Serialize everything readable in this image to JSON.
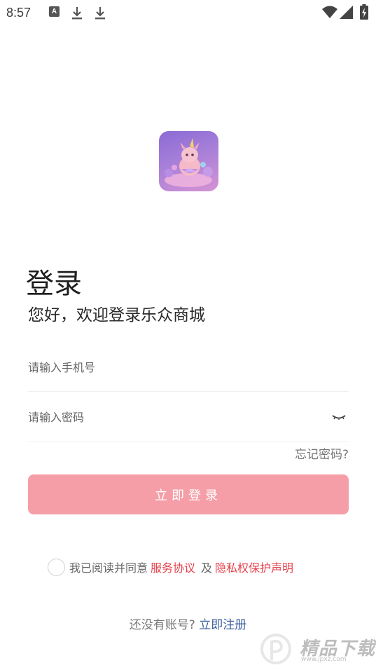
{
  "status_bar": {
    "time": "8:57",
    "icons": [
      "a-notification-icon",
      "download-icon",
      "download-icon",
      "wifi-icon",
      "signal-icon",
      "battery-charging-icon"
    ],
    "a_icon_letter": "A"
  },
  "logo": {
    "icon": "app-logo-unicorn"
  },
  "header": {
    "title": "登录",
    "subtitle": "您好，欢迎登录乐众商城"
  },
  "form": {
    "phone_placeholder": "请输入手机号",
    "phone_value": "",
    "password_placeholder": "请输入密码",
    "password_value": "",
    "forgot_label": "忘记密码?",
    "login_label": "立即登录"
  },
  "agreement": {
    "prefix": "我已阅读并同意",
    "service_link": "服务协议",
    "and": "及",
    "privacy_link": "隐私权保护声明",
    "checked": false
  },
  "register": {
    "prefix": "还没有账号?",
    "link": "立即注册"
  },
  "watermark": {
    "text": "精品下载",
    "url": "www.jpxz.com"
  },
  "colors": {
    "accent_button": "#f59ea7",
    "link_red": "#e5424b",
    "link_blue": "#3c5fa0"
  }
}
